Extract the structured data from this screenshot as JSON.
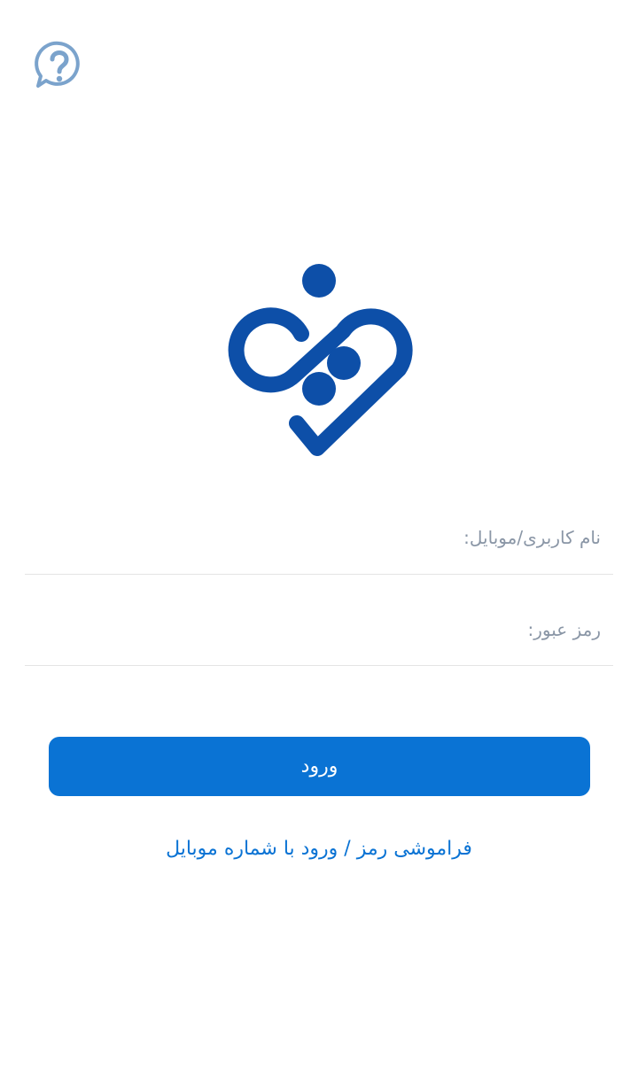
{
  "colors": {
    "primary": "#0a73d4",
    "logo": "#0d4fa8",
    "help_icon": "#7ba3cc",
    "divider": "#e4e4e4",
    "placeholder": "#8a96a6"
  },
  "header": {
    "help_icon": "help-question-bubble-icon"
  },
  "logo": {
    "icon": "heart-infinity-logo"
  },
  "form": {
    "username": {
      "placeholder": "نام کاربری/موبایل:",
      "value": ""
    },
    "password": {
      "placeholder": "رمز عبور:",
      "value": ""
    },
    "login_label": "ورود",
    "forgot_label": "فراموشی رمز / ورود با شماره موبایل"
  }
}
